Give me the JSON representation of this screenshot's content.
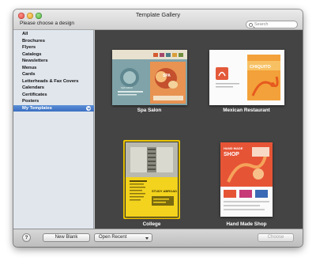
{
  "window": {
    "title": "Template Gallery",
    "prompt": "Please choose a design"
  },
  "search": {
    "placeholder": "Search"
  },
  "sidebar": {
    "items": [
      {
        "label": "All",
        "selected": false
      },
      {
        "label": "Brochures",
        "selected": false
      },
      {
        "label": "Flyers",
        "selected": false
      },
      {
        "label": "Catalogs",
        "selected": false
      },
      {
        "label": "Newsletters",
        "selected": false
      },
      {
        "label": "Menus",
        "selected": false
      },
      {
        "label": "Cards",
        "selected": false
      },
      {
        "label": "Letterheads & Fax Covers",
        "selected": false
      },
      {
        "label": "Calendars",
        "selected": false
      },
      {
        "label": "Certificates",
        "selected": false
      },
      {
        "label": "Posters",
        "selected": false
      },
      {
        "label": "My Templates",
        "selected": true
      }
    ]
  },
  "templates": [
    {
      "label": "Spa Salon",
      "selected": false,
      "brand": "SPA",
      "brand_sub": "spa salon"
    },
    {
      "label": "Mexican Restaurant",
      "selected": false,
      "brand": "CHIQUITO"
    },
    {
      "label": "College",
      "selected": true,
      "headline": "STUDY ABROAD"
    },
    {
      "label": "Hand Made Shop",
      "selected": false,
      "brand": "HAND MADE",
      "brand2": "SHOP"
    }
  ],
  "footer": {
    "help_label": "?",
    "new_blank_label": "New Blank",
    "open_recent_label": "Open Recent",
    "choose_label": "Choose"
  },
  "colors": {
    "gallery_bg": "#444444",
    "sidebar_bg": "#e1e6ed",
    "selection": "#3b6fc2",
    "highlight": "#f0c800"
  }
}
